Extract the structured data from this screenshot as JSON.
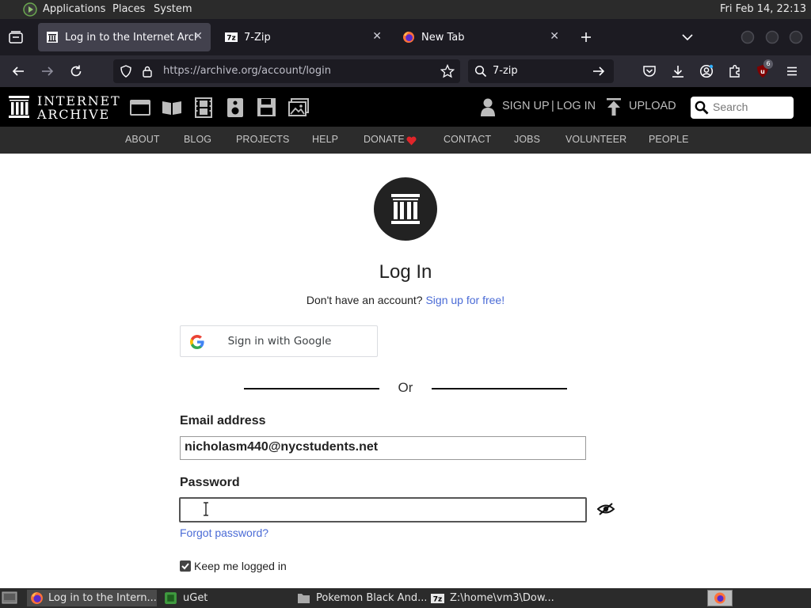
{
  "system_panel": {
    "menus": [
      "Applications",
      "Places",
      "System"
    ],
    "clock": "Fri Feb 14, 22:13"
  },
  "browser": {
    "tabs": [
      {
        "title": "Log in to the Internet Archive",
        "active": true
      },
      {
        "title": "7-Zip",
        "active": false
      },
      {
        "title": "New Tab",
        "active": false
      }
    ],
    "url": "https://archive.org/account/login",
    "search_value": "7-zip",
    "extension_badge": "6"
  },
  "ia_header": {
    "logo_line1": "INTERNET",
    "logo_line2": "ARCHIVE",
    "sign_up": "SIGN UP",
    "separator": "|",
    "log_in": "LOG IN",
    "upload": "UPLOAD",
    "search_placeholder": "Search"
  },
  "ia_subnav": [
    "ABOUT",
    "BLOG",
    "PROJECTS",
    "HELP",
    "DONATE",
    "CONTACT",
    "JOBS",
    "VOLUNTEER",
    "PEOPLE"
  ],
  "login": {
    "title": "Log In",
    "no_account": "Don't have an account?",
    "signup_link": "Sign up for free!",
    "google_button": "Sign in with Google",
    "or": "Or",
    "email_label": "Email address",
    "email_value": "nicholasm440@nycstudents.net",
    "password_label": "Password",
    "password_value": "",
    "forgot": "Forgot password?",
    "keep_logged_in": "Keep me logged in",
    "keep_checked": true
  },
  "taskbar": {
    "items": [
      "Log in to the Intern...",
      "uGet",
      "Pokemon Black And...",
      "Z:\\home\\vm3\\Dow..."
    ]
  },
  "colors": {
    "link": "#4a6bd6",
    "donate_heart": "#e0252a",
    "ia_header_bg": "#000000",
    "ia_subnav_bg": "#2c2c2c"
  }
}
